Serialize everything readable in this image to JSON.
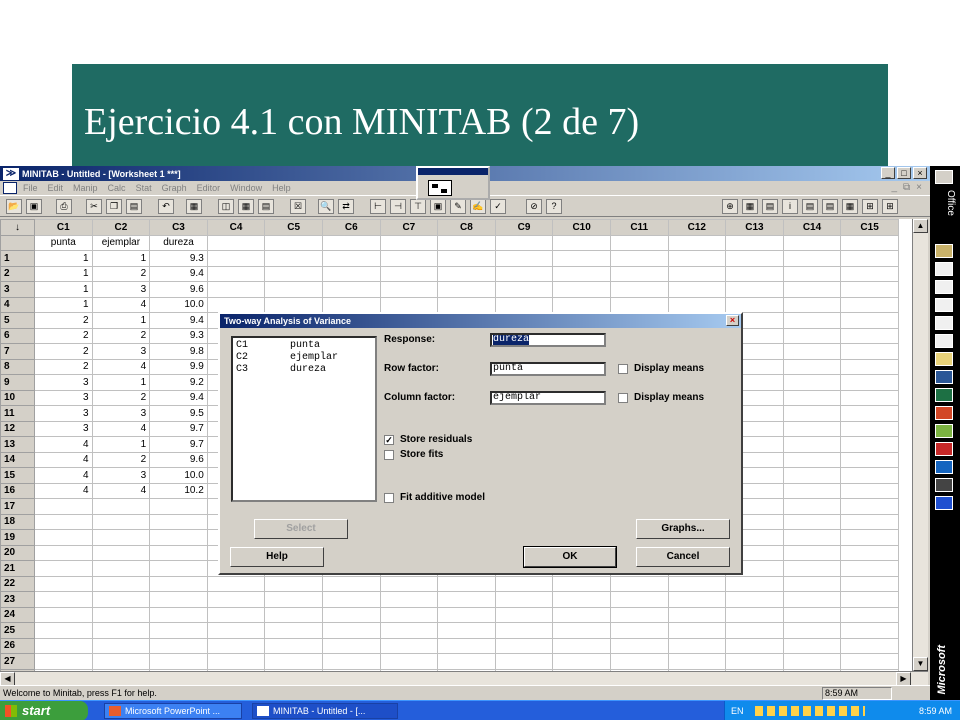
{
  "slide": {
    "title": "Ejercicio 4.1 con MINITAB (2 de 7)"
  },
  "window": {
    "title": "MINITAB - Untitled - [Worksheet 1 ***]"
  },
  "menu": [
    "File",
    "Edit",
    "Manip",
    "Calc",
    "Stat",
    "Graph",
    "Editor",
    "Window",
    "Help"
  ],
  "sheet": {
    "columns": [
      "C1",
      "C2",
      "C3",
      "C4",
      "C5",
      "C6",
      "C7",
      "C8",
      "C9",
      "C10",
      "C11",
      "C12",
      "C13",
      "C14",
      "C15"
    ],
    "column_names": [
      "punta",
      "ejemplar",
      "dureza",
      "",
      "",
      "",
      "",
      "",
      "",
      "",
      "",
      "",
      "",
      "",
      ""
    ],
    "rows": [
      [
        "1",
        "1",
        "9.3"
      ],
      [
        "1",
        "2",
        "9.4"
      ],
      [
        "1",
        "3",
        "9.6"
      ],
      [
        "1",
        "4",
        "10.0"
      ],
      [
        "2",
        "1",
        "9.4"
      ],
      [
        "2",
        "2",
        "9.3"
      ],
      [
        "2",
        "3",
        "9.8"
      ],
      [
        "2",
        "4",
        "9.9"
      ],
      [
        "3",
        "1",
        "9.2"
      ],
      [
        "3",
        "2",
        "9.4"
      ],
      [
        "3",
        "3",
        "9.5"
      ],
      [
        "3",
        "4",
        "9.7"
      ],
      [
        "4",
        "1",
        "9.7"
      ],
      [
        "4",
        "2",
        "9.6"
      ],
      [
        "4",
        "3",
        "10.0"
      ],
      [
        "4",
        "4",
        "10.2"
      ]
    ],
    "row_count": 28
  },
  "dialog": {
    "title": "Two-way Analysis of Variance",
    "variables": [
      {
        "col": "C1",
        "name": "punta"
      },
      {
        "col": "C2",
        "name": "ejemplar"
      },
      {
        "col": "C3",
        "name": "dureza"
      }
    ],
    "response_label": "Response:",
    "response_value": "dureza",
    "row_factor_label": "Row factor:",
    "row_factor_value": "punta",
    "column_factor_label": "Column factor:",
    "column_factor_value": "ejemplar",
    "display_means_label": "Display means",
    "display_means_row_checked": false,
    "display_means_col_checked": false,
    "store_residuals_label": "Store residuals",
    "store_residuals_checked": true,
    "store_fits_label": "Store fits",
    "store_fits_checked": false,
    "fit_additive_label": "Fit additive model",
    "fit_additive_checked": false,
    "select_label": "Select",
    "graphs_label": "Graphs...",
    "help_label": "Help",
    "ok_label": "OK",
    "cancel_label": "Cancel"
  },
  "status": {
    "message": "Welcome to Minitab, press F1 for help.",
    "time": "8:59 AM"
  },
  "taskbar": {
    "start": "start",
    "tasks": [
      "Microsoft PowerPoint ...",
      "MINITAB - Untitled - [..."
    ],
    "lang": "EN",
    "time": "8:59 AM"
  },
  "office_bar": {
    "top_label": "Office",
    "bottom_label": "Microsoft"
  },
  "icons": [
    "search-icon",
    "office-icon"
  ]
}
